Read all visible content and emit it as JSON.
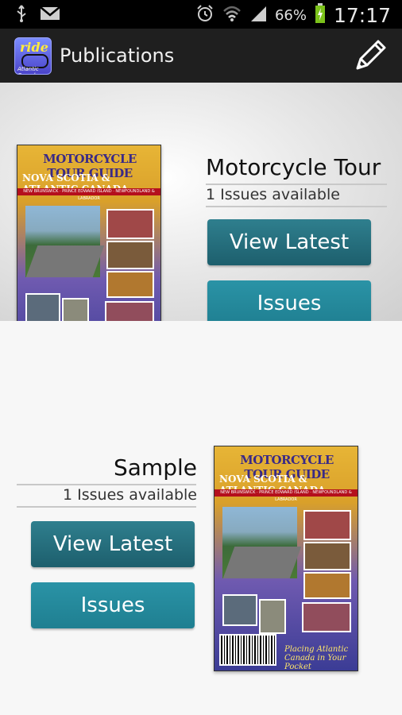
{
  "status_bar": {
    "battery_percent": "66%",
    "time": "17:17",
    "icons": [
      "usb-icon",
      "gmail-icon",
      "alarm-icon",
      "wifi-icon",
      "signal-icon",
      "battery-icon"
    ]
  },
  "action_bar": {
    "title": "Publications",
    "logo_text": "ride",
    "logo_subtext": "Atlantic Canada",
    "edit_icon": "pencil-icon"
  },
  "cover": {
    "title": "MOTORCYCLE TOUR GUIDE",
    "region": "NOVA SCOTIA & ATLANTIC CANADA",
    "strip": "NEW BRUNSWICK · PRINCE EDWARD ISLAND · NEWFOUNDLAND & LABRADOR",
    "tagline": "Placing Atlantic Canada in Your Pocket"
  },
  "publications": [
    {
      "name": "Motorcycle Tour",
      "availability": "1 Issues available",
      "view_latest_label": "View Latest",
      "issues_label": "Issues"
    },
    {
      "name": "Sample",
      "availability": "1 Issues available",
      "view_latest_label": "View Latest",
      "issues_label": "Issues"
    }
  ],
  "colors": {
    "action_bar": "#1f1f1f",
    "button_teal": "#1f7f91",
    "button_teal_dark": "#1d5f6d"
  }
}
